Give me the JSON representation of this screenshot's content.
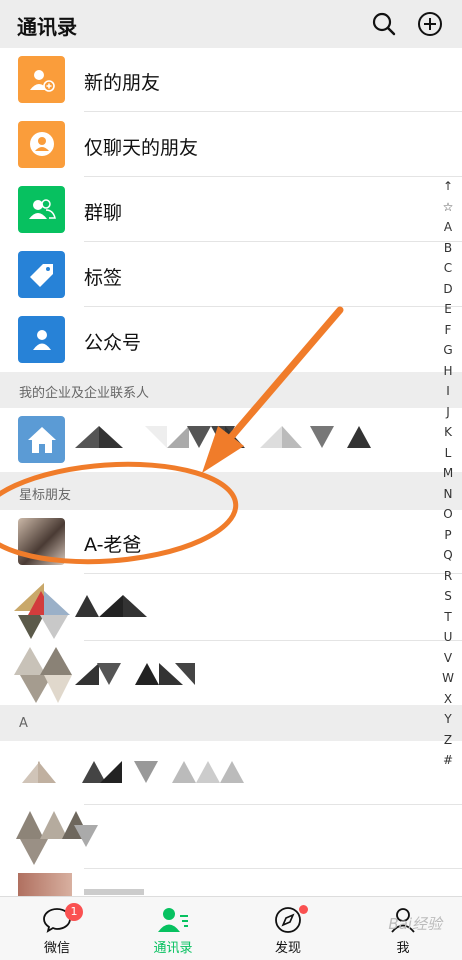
{
  "header": {
    "title": "通讯录",
    "search_icon": "search-icon",
    "add_icon": "add-circle-icon"
  },
  "functions": [
    {
      "label": "新的朋友",
      "color": "#fa9d3b",
      "icon": "new-friend-icon"
    },
    {
      "label": "仅聊天的朋友",
      "color": "#fa9d3b",
      "icon": "chat-only-friend-icon"
    },
    {
      "label": "群聊",
      "color": "#07c160",
      "icon": "group-chat-icon"
    },
    {
      "label": "标签",
      "color": "#2782d7",
      "icon": "tag-icon"
    },
    {
      "label": "公众号",
      "color": "#2782d7",
      "icon": "official-account-icon"
    }
  ],
  "sections": {
    "enterprise": "我的企业及企业联系人",
    "starred": "星标朋友",
    "a": "A"
  },
  "starred_contact": {
    "name": "A-老爸"
  },
  "alphabet": [
    "↑",
    "☆",
    "A",
    "B",
    "C",
    "D",
    "E",
    "F",
    "G",
    "H",
    "I",
    "J",
    "K",
    "L",
    "M",
    "N",
    "O",
    "P",
    "Q",
    "R",
    "S",
    "T",
    "U",
    "V",
    "W",
    "X",
    "Y",
    "Z",
    "#"
  ],
  "tabs": [
    {
      "label": "微信",
      "badge": "1",
      "icon": "chat-bubble-icon"
    },
    {
      "label": "通讯录",
      "icon": "contacts-icon",
      "active": true
    },
    {
      "label": "发现",
      "icon": "compass-icon"
    },
    {
      "label": "我",
      "icon": "profile-icon"
    }
  ],
  "watermark": "Bai经验",
  "colors": {
    "accent": "#07c160",
    "annotation": "#f07c2a",
    "badge": "#fa5151"
  }
}
